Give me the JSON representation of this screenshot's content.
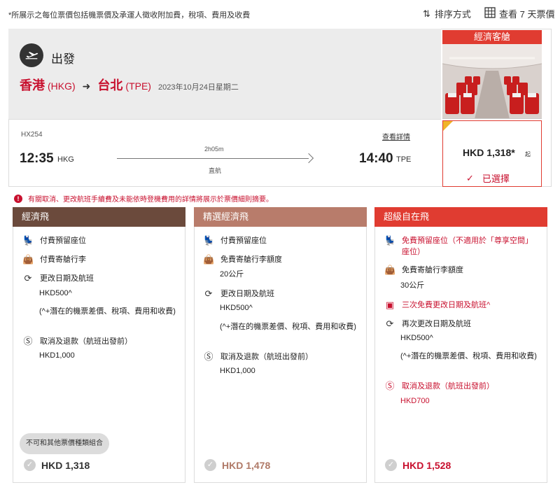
{
  "top_bar": {
    "disclaimer": "*所展示之每位票價包括機票價及承運人徵收附加費，稅項、費用及收費",
    "sort_label": "排序方式",
    "week_label": "查看 7 天票價"
  },
  "flight": {
    "direction_label": "出發",
    "origin_city": "香港",
    "origin_code": "(HKG)",
    "destination_city": "台北",
    "destination_code": "(TPE)",
    "date": "2023年10月24日星期二",
    "flight_number": "HX254",
    "details_link": "查看詳情",
    "departure_time": "12:35",
    "departure_airport": "HKG",
    "duration": "2h05m",
    "stops": "直航",
    "arrival_time": "14:40",
    "arrival_airport": "TPE"
  },
  "cabin": {
    "name": "經濟客艙",
    "price": "HKD 1,318*",
    "price_suffix": "起",
    "selected_label": "已選擇"
  },
  "warning": {
    "text": "有關取消、更改航班手續費及未能依時登機費用的詳情將展示於票價細則摘要。"
  },
  "fares": [
    {
      "name": "經濟飛",
      "color": "#6b4a3c",
      "seat": "付費預留座位",
      "baggage": "付費寄艙行李",
      "change": "更改日期及航班",
      "change_fee": "HKD500^",
      "change_note": "(^+潛在的機票差價、稅項、費用和收費)",
      "refund": "取消及退款（航班出發前）",
      "refund_fee": "HKD1,000",
      "badge": "不可和其他票價種類組合",
      "price": "HKD 1,318",
      "price_color": "#333333"
    },
    {
      "name": "精選經濟飛",
      "color": "#b87c6b",
      "seat": "付費預留座位",
      "baggage": "免費寄艙行李額度",
      "baggage_amount": "20公斤",
      "change": "更改日期及航班",
      "change_fee": "HKD500^",
      "change_note": "(^+潛在的機票差價、稅項、費用和收費)",
      "refund": "取消及退款（航班出發前）",
      "refund_fee": "HKD1,000",
      "price": "HKD 1,478",
      "price_color": "#b07a68"
    },
    {
      "name": "超級自在飛",
      "color": "#e03c31",
      "seat": "免費預留座位（不適用於「尊享空間」座位）",
      "baggage": "免費寄艙行李額度",
      "baggage_amount": "30公斤",
      "free_change": "三次免費更改日期及航班^",
      "change": "再次更改日期及航班",
      "change_fee": "HKD500^",
      "change_note": "(^+潛在的機票差價、稅項、費用和收費)",
      "refund": "取消及退款（航班出發前）",
      "refund_fee": "HKD700",
      "price": "HKD 1,528",
      "price_color": "#c8102e"
    }
  ],
  "icons": {
    "seat": "seat-icon",
    "baggage": "baggage-icon",
    "change": "refresh-icon",
    "refund": "dollar-icon",
    "calendar": "calendar-check-icon",
    "plane": "plane-icon",
    "check": "check-icon"
  }
}
